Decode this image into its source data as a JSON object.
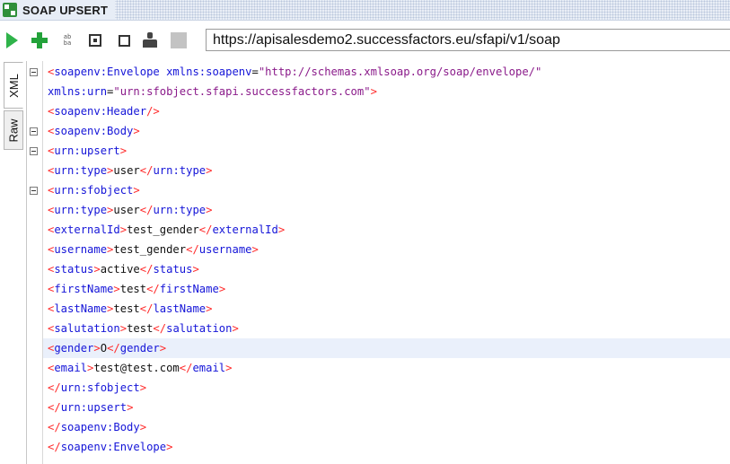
{
  "window": {
    "title": "SOAP UPSERT"
  },
  "toolbar": {
    "url": "https://apisalesdemo2.successfactors.eu/sfapi/v1/soap",
    "buttons": [
      "play-icon",
      "plus-icon",
      "sort-icon",
      "zoom-icon",
      "square-icon",
      "person-icon",
      "gray-square-icon"
    ]
  },
  "tabs": [
    "XML",
    "Raw"
  ],
  "editor": {
    "lines": [
      {
        "parts": [
          [
            "t",
            "<"
          ],
          [
            "n",
            "soapenv:Envelope "
          ],
          [
            "n",
            "xmlns:soapenv"
          ],
          [
            "x",
            "="
          ],
          [
            "v",
            "\"http://schemas.xmlsoap.org/soap/envelope/\""
          ]
        ]
      },
      {
        "parts": [
          [
            "n",
            "xmlns:urn"
          ],
          [
            "x",
            "="
          ],
          [
            "v",
            "\"urn:sfobject.sfapi.successfactors.com\""
          ],
          [
            "t",
            ">"
          ]
        ]
      },
      {
        "parts": [
          [
            "t",
            "<"
          ],
          [
            "n",
            "soapenv:Header"
          ],
          [
            "t",
            "/>"
          ]
        ]
      },
      {
        "parts": [
          [
            "t",
            "<"
          ],
          [
            "n",
            "soapenv:Body"
          ],
          [
            "t",
            ">"
          ]
        ]
      },
      {
        "parts": [
          [
            "t",
            "<"
          ],
          [
            "n",
            "urn:upsert"
          ],
          [
            "t",
            ">"
          ]
        ]
      },
      {
        "parts": [
          [
            "t",
            "<"
          ],
          [
            "n",
            "urn:type"
          ],
          [
            "t",
            ">"
          ],
          [
            "x",
            "user"
          ],
          [
            "t",
            "</"
          ],
          [
            "n",
            "urn:type"
          ],
          [
            "t",
            ">"
          ]
        ]
      },
      {
        "parts": [
          [
            "t",
            "<"
          ],
          [
            "n",
            "urn:sfobject"
          ],
          [
            "t",
            ">"
          ]
        ]
      },
      {
        "parts": [
          [
            "t",
            "<"
          ],
          [
            "n",
            "urn:type"
          ],
          [
            "t",
            ">"
          ],
          [
            "x",
            "user"
          ],
          [
            "t",
            "</"
          ],
          [
            "n",
            "urn:type"
          ],
          [
            "t",
            ">"
          ]
        ]
      },
      {
        "parts": [
          [
            "t",
            "<"
          ],
          [
            "n",
            "externalId"
          ],
          [
            "t",
            ">"
          ],
          [
            "x",
            "test_gender"
          ],
          [
            "t",
            "</"
          ],
          [
            "n",
            "externalId"
          ],
          [
            "t",
            ">"
          ]
        ]
      },
      {
        "parts": [
          [
            "t",
            "<"
          ],
          [
            "n",
            "username"
          ],
          [
            "t",
            ">"
          ],
          [
            "x",
            "test_gender"
          ],
          [
            "t",
            "</"
          ],
          [
            "n",
            "username"
          ],
          [
            "t",
            ">"
          ]
        ]
      },
      {
        "parts": [
          [
            "t",
            "<"
          ],
          [
            "n",
            "status"
          ],
          [
            "t",
            ">"
          ],
          [
            "x",
            "active"
          ],
          [
            "t",
            "</"
          ],
          [
            "n",
            "status"
          ],
          [
            "t",
            ">"
          ]
        ]
      },
      {
        "parts": [
          [
            "t",
            "<"
          ],
          [
            "n",
            "firstName"
          ],
          [
            "t",
            ">"
          ],
          [
            "x",
            "test"
          ],
          [
            "t",
            "</"
          ],
          [
            "n",
            "firstName"
          ],
          [
            "t",
            ">"
          ]
        ]
      },
      {
        "parts": [
          [
            "t",
            "<"
          ],
          [
            "n",
            "lastName"
          ],
          [
            "t",
            ">"
          ],
          [
            "x",
            "test"
          ],
          [
            "t",
            "</"
          ],
          [
            "n",
            "lastName"
          ],
          [
            "t",
            ">"
          ]
        ]
      },
      {
        "parts": [
          [
            "t",
            "<"
          ],
          [
            "n",
            "salutation"
          ],
          [
            "t",
            ">"
          ],
          [
            "x",
            "test"
          ],
          [
            "t",
            "</"
          ],
          [
            "n",
            "salutation"
          ],
          [
            "t",
            ">"
          ]
        ]
      },
      {
        "parts": [
          [
            "t",
            "<"
          ],
          [
            "n",
            "gender"
          ],
          [
            "t",
            ">"
          ],
          [
            "x",
            "O"
          ],
          [
            "t",
            "</"
          ],
          [
            "n",
            "gender"
          ],
          [
            "t",
            ">"
          ]
        ],
        "highlighted": true
      },
      {
        "parts": [
          [
            "t",
            "<"
          ],
          [
            "n",
            "email"
          ],
          [
            "t",
            ">"
          ],
          [
            "x",
            "test@test.com"
          ],
          [
            "t",
            "</"
          ],
          [
            "n",
            "email"
          ],
          [
            "t",
            ">"
          ]
        ]
      },
      {
        "parts": [
          [
            "t",
            "</"
          ],
          [
            "n",
            "urn:sfobject"
          ],
          [
            "t",
            ">"
          ]
        ]
      },
      {
        "parts": [
          [
            "t",
            "</"
          ],
          [
            "n",
            "urn:upsert"
          ],
          [
            "t",
            ">"
          ]
        ]
      },
      {
        "parts": [
          [
            "t",
            "</"
          ],
          [
            "n",
            "soapenv:Body"
          ],
          [
            "t",
            ">"
          ]
        ]
      },
      {
        "parts": [
          [
            "t",
            "</"
          ],
          [
            "n",
            "soapenv:Envelope"
          ],
          [
            "t",
            ">"
          ]
        ]
      }
    ],
    "fold_lines": [
      0,
      3,
      4,
      6
    ]
  },
  "colors": {
    "bracket": "#ff2b2b",
    "tag_name": "#1515d8",
    "attr_value": "#8a1a8a",
    "text": "#111111",
    "highlight": "#eaf0fb"
  }
}
